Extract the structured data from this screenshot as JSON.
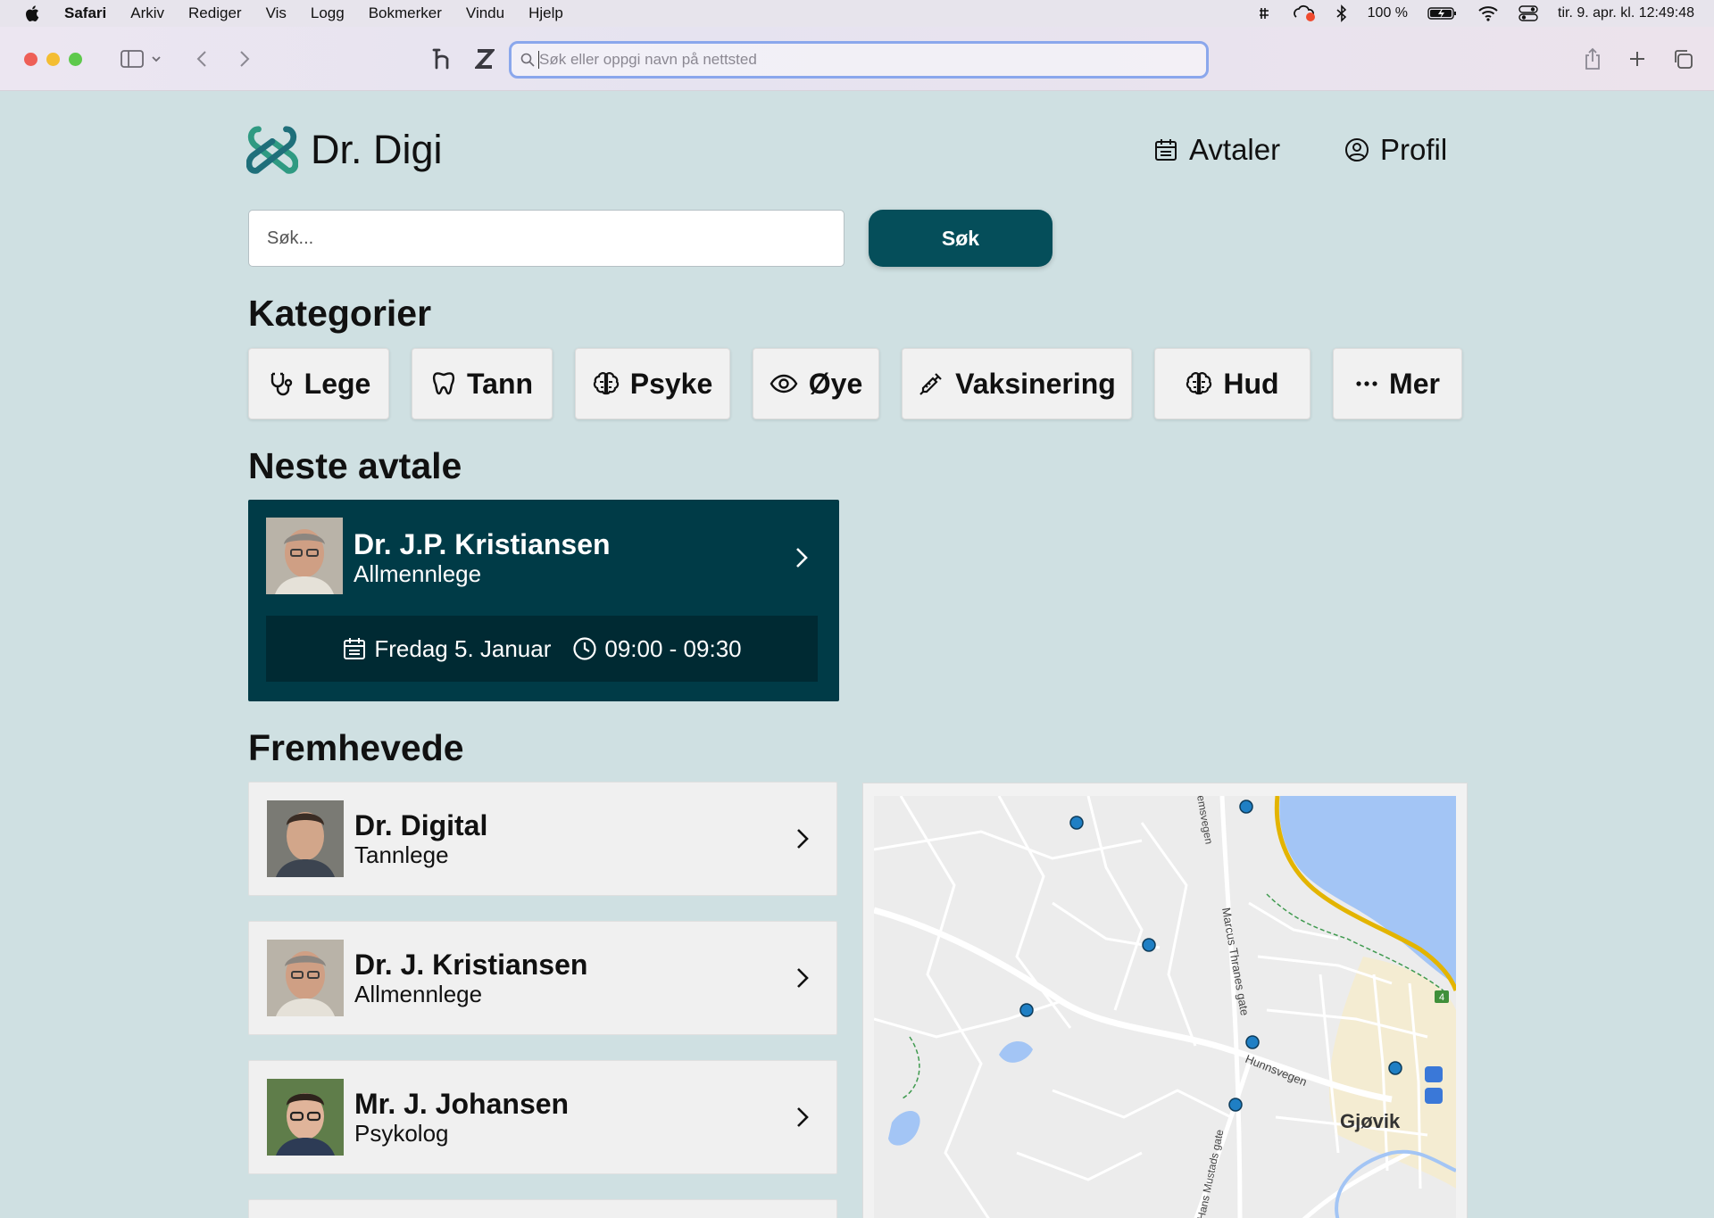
{
  "menubar": {
    "app": "Safari",
    "items": [
      "Arkiv",
      "Rediger",
      "Vis",
      "Logg",
      "Bokmerker",
      "Vindu",
      "Hjelp"
    ],
    "battery": "100 %",
    "clock": "tir. 9. apr. kl. 12:49:48"
  },
  "browser": {
    "address_placeholder": "Søk eller oppgi navn på nettsted"
  },
  "site": {
    "logo_text": "Dr. Digi",
    "nav": {
      "appointments": "Avtaler",
      "profile": "Profil"
    },
    "search": {
      "placeholder": "Søk...",
      "button": "Søk"
    }
  },
  "categories": {
    "title": "Kategorier",
    "items": [
      {
        "label": "Lege",
        "icon": "stethoscope-icon"
      },
      {
        "label": "Tann",
        "icon": "tooth-icon"
      },
      {
        "label": "Psyke",
        "icon": "brain-icon"
      },
      {
        "label": "Øye",
        "icon": "eye-icon"
      },
      {
        "label": "Vaksinering",
        "icon": "syringe-icon"
      },
      {
        "label": "Hud",
        "icon": "skin-icon"
      },
      {
        "label": "Mer",
        "icon": "more-icon"
      }
    ]
  },
  "next_appointment": {
    "title": "Neste avtale",
    "doctor": "Dr. J.P. Kristiansen",
    "role": "Allmennlege",
    "date": "Fredag 5. Januar",
    "time": "09:00 - 09:30"
  },
  "featured": {
    "title": "Fremhevede",
    "items": [
      {
        "name": "Dr. Digital",
        "role": "Tannlege"
      },
      {
        "name": "Dr. J. Kristiansen",
        "role": "Allmennlege"
      },
      {
        "name": "Mr. J. Johansen",
        "role": "Psykolog"
      }
    ]
  },
  "map": {
    "place_label": "Gjøvik",
    "street_labels": [
      "Marcus Thranes gate",
      "Hunnsvegen",
      "Hans Mustads gate",
      "emsvegen"
    ],
    "route_badge": "4"
  },
  "colors": {
    "page_bg": "#cfe0e2",
    "primary": "#054e5a",
    "appointment_bg": "#003b47",
    "appointment_bar": "#002a33",
    "logo_green": "#2f9a82",
    "map_water": "#a3c5f5",
    "map_marker": "#1f7fc4"
  }
}
